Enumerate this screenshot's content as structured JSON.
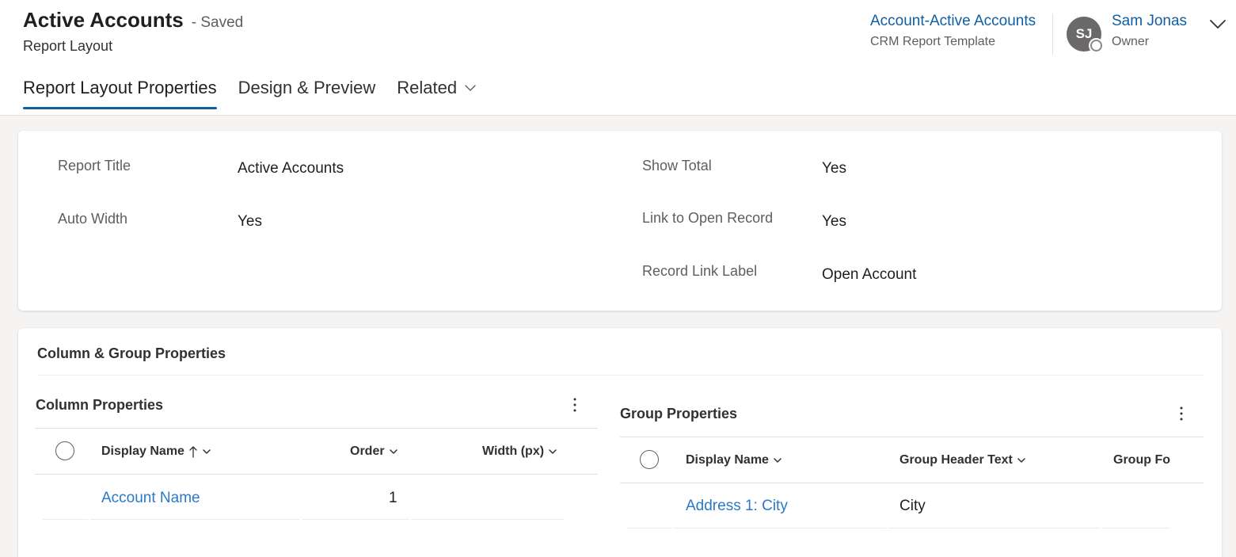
{
  "header": {
    "title": "Active Accounts",
    "saved_status": "- Saved",
    "entity": "Report Layout",
    "template_link": "Account-Active Accounts",
    "template_type": "CRM Report Template",
    "avatar_initials": "SJ",
    "owner_name": "Sam Jonas",
    "owner_role": "Owner"
  },
  "tabs": [
    {
      "label": "Report Layout Properties",
      "active": true
    },
    {
      "label": "Design & Preview",
      "active": false
    },
    {
      "label": "Related",
      "active": false
    }
  ],
  "properties": {
    "report_title_label": "Report Title",
    "report_title_value": "Active Accounts",
    "auto_width_label": "Auto Width",
    "auto_width_value": "Yes",
    "show_total_label": "Show Total",
    "show_total_value": "Yes",
    "link_open_record_label": "Link to Open Record",
    "link_open_record_value": "Yes",
    "record_link_label_label": "Record Link Label",
    "record_link_label_value": "Open Account"
  },
  "column_group": {
    "section_title": "Column & Group Properties",
    "column_properties": {
      "title": "Column Properties",
      "headers": {
        "display_name": "Display Name",
        "order": "Order",
        "width": "Width (px)"
      },
      "rows": [
        {
          "display_name": "Account Name",
          "order": "1",
          "width": ""
        }
      ]
    },
    "group_properties": {
      "title": "Group Properties",
      "headers": {
        "display_name": "Display Name",
        "group_header_text": "Group Header Text",
        "group_footer": "Group Fo"
      },
      "rows": [
        {
          "display_name": "Address 1: City",
          "group_header_text": "City"
        }
      ]
    }
  },
  "colors": {
    "accent": "#115ea3",
    "link": "#2b79c7",
    "background": "#f5f4f3"
  }
}
